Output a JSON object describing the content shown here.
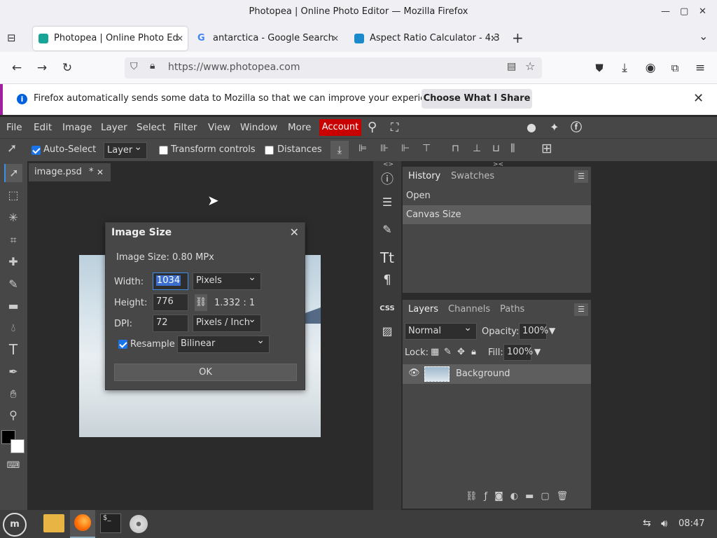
{
  "window": {
    "title": "Photopea | Online Photo Editor — Mozilla Firefox"
  },
  "tabs": [
    {
      "label": "Photopea | Online Photo Ed",
      "active": true
    },
    {
      "label": "antarctica - Google Search",
      "active": false
    },
    {
      "label": "Aspect Ratio Calculator - 4:3",
      "active": false
    }
  ],
  "nav": {
    "url": "https://www.photopea.com"
  },
  "notification": {
    "message": "Firefox automatically sends some data to Mozilla so that we can improve your experience.",
    "button": "Choose What I Share"
  },
  "menubar": {
    "items": [
      "File",
      "Edit",
      "Image",
      "Layer",
      "Select",
      "Filter",
      "View",
      "Window",
      "More"
    ],
    "account": "Account"
  },
  "options": {
    "auto_select": "Auto-Select",
    "layer_select": "Layer",
    "transform_controls": "Transform controls",
    "distances": "Distances"
  },
  "document": {
    "tab_label": "image.psd",
    "modified": "*"
  },
  "dialog": {
    "title": "Image Size",
    "image_size": "Image Size: 0.80 MPx",
    "width_label": "Width:",
    "width_value": "1034",
    "width_unit": "Pixels",
    "height_label": "Height:",
    "height_value": "776",
    "ratio": "1.332 : 1",
    "dpi_label": "DPI:",
    "dpi_value": "72",
    "dpi_unit": "Pixels / Inch",
    "resample_label": "Resample",
    "resample_value": "Bilinear",
    "ok": "OK"
  },
  "history_panel": {
    "tabs": [
      "History",
      "Swatches"
    ],
    "items": [
      "Open",
      "Canvas Size"
    ]
  },
  "layers_panel": {
    "tabs": [
      "Layers",
      "Channels",
      "Paths"
    ],
    "blend_mode": "Normal",
    "opacity_label": "Opacity:",
    "opacity_value": "100%",
    "lock_label": "Lock:",
    "fill_label": "Fill:",
    "fill_value": "100%",
    "layer_name": "Background"
  },
  "taskbar": {
    "time": "08:47"
  },
  "colors": {
    "accent_red": "#c80000",
    "panel": "#474747",
    "background": "#2b2b2b"
  }
}
